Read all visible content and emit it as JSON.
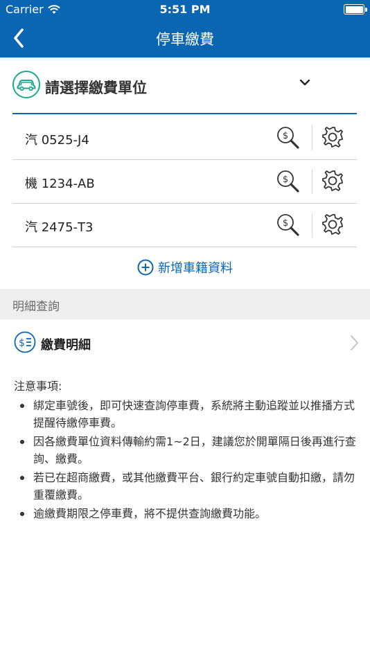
{
  "status_bar": {
    "carrier": "Carrier",
    "time": "5:51 PM"
  },
  "nav": {
    "title": "停車繳費"
  },
  "unit_selector": {
    "label": "請選擇繳費單位"
  },
  "plates": [
    {
      "plate": "汽 0525-J4"
    },
    {
      "plate": "機 1234-AB"
    },
    {
      "plate": "汽 2475-T3"
    }
  ],
  "add_vehicle": {
    "label": "新增車籍資料"
  },
  "detail_section": {
    "header": "明細查詢",
    "fee_detail_label": "繳費明細"
  },
  "notice": {
    "title": "注意事項:",
    "items": [
      "綁定車號後，即可快速查詢停車費，系統將主動追蹤並以推播方式提醒待繳停車費。",
      "因各繳費單位資料傳輸約需1~2日，建議您於開單隔日後再進行查詢、繳費。",
      "若已在超商繳費，或其他繳費平台、銀行約定車號自動扣繳，請勿重覆繳費。",
      "逾繳費期限之停車費，將不提供查詢繳費功能。"
    ]
  },
  "colors": {
    "brand_blue": "#0a66b3",
    "teal_icon": "#1aa890",
    "section_bg": "#efefef"
  },
  "icons": {
    "back": "chevron-left-icon",
    "car": "car-icon",
    "dropdown": "chevron-down-icon",
    "query": "money-search-icon",
    "settings": "gear-icon",
    "add": "plus-circle-icon",
    "fee": "dollar-list-icon",
    "arrow": "chevron-right-icon"
  }
}
